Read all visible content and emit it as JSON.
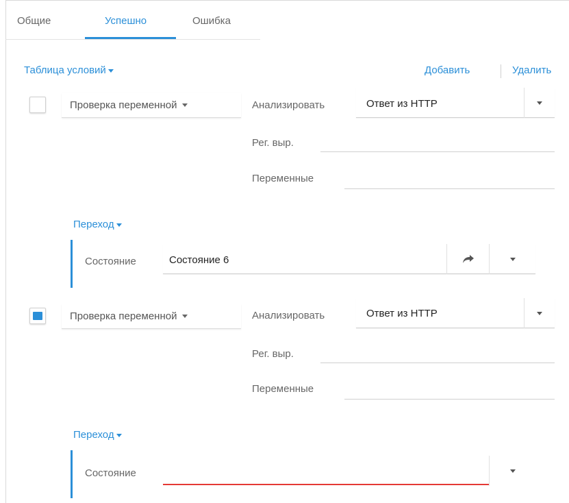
{
  "tabs": [
    {
      "label": "Общие"
    },
    {
      "label": "Успешно",
      "active": true
    },
    {
      "label": "Ошибка"
    }
  ],
  "toolbar": {
    "table_label": "Таблица условий",
    "add_label": "Добавить",
    "delete_label": "Удалить"
  },
  "conditions": [
    {
      "checked": false,
      "type_label": "Проверка переменной",
      "analyze_label": "Анализировать",
      "analyze_value": "Ответ из HTTP",
      "regex_label": "Рег. выр.",
      "regex_value": "",
      "vars_label": "Переменные",
      "vars_value": "",
      "transition_label": "Переход",
      "state_label": "Состояние",
      "state_value": "Состояние 6"
    },
    {
      "checked": true,
      "type_label": "Проверка переменной",
      "analyze_label": "Анализировать",
      "analyze_value": "Ответ из HTTP",
      "regex_label": "Рег. выр.",
      "regex_value": "",
      "vars_label": "Переменные",
      "vars_value": "",
      "transition_label": "Переход",
      "state_label": "Состояние",
      "state_value": ""
    }
  ],
  "colors": {
    "accent": "#2b8fd8",
    "error": "#e53935"
  },
  "icons": {
    "goto": "share-arrow-icon",
    "dropdown": "caret-down-icon"
  }
}
